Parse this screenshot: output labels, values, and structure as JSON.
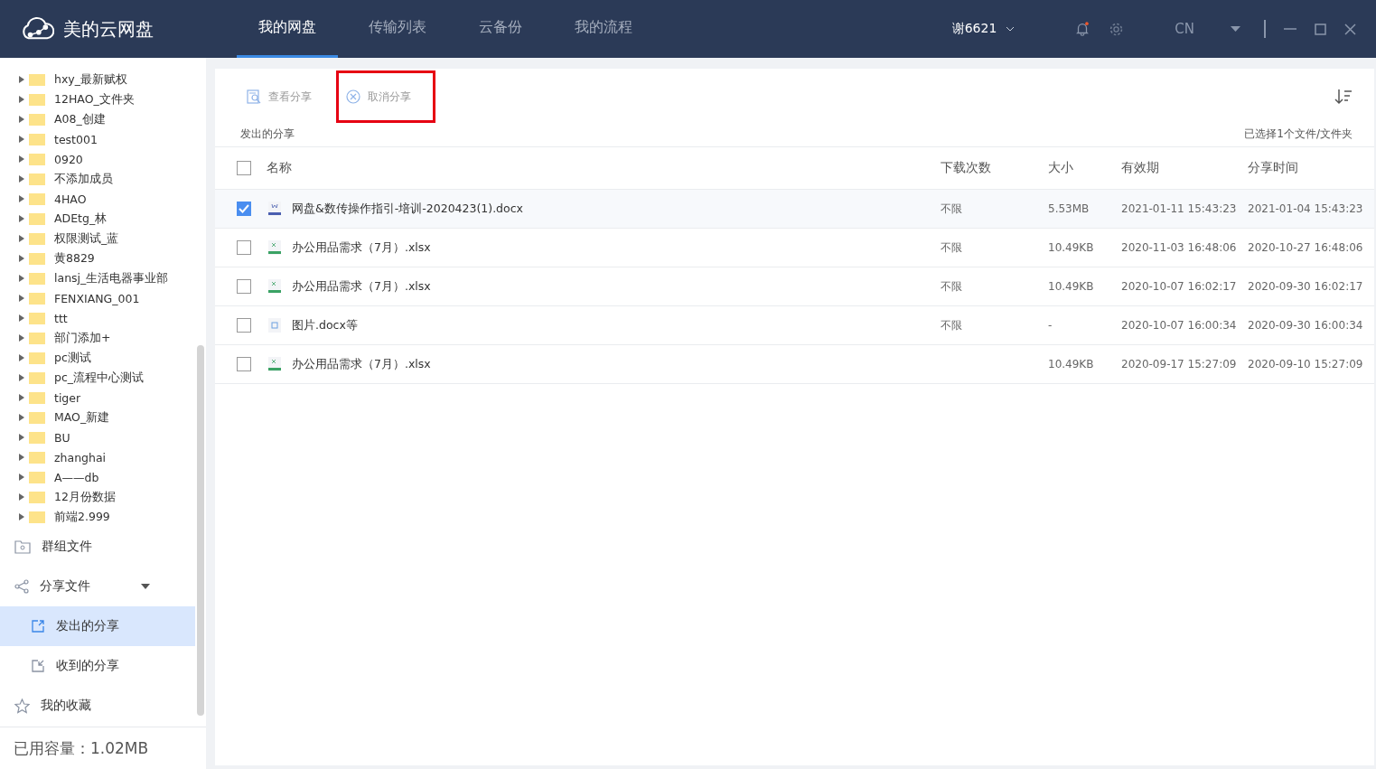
{
  "header": {
    "app_name": "美的云网盘",
    "tabs": [
      {
        "label": "我的网盘",
        "selected": true
      },
      {
        "label": "传输列表",
        "selected": false
      },
      {
        "label": "云备份",
        "selected": false
      },
      {
        "label": "我的流程",
        "selected": false
      }
    ],
    "user": "谢6621",
    "notification_unread": true,
    "language": "CN"
  },
  "sidebar": {
    "folders": [
      {
        "name": "hxy_最新赋权"
      },
      {
        "name": "12HAO_文件夹"
      },
      {
        "name": "A08_创建"
      },
      {
        "name": "test001"
      },
      {
        "name": "0920"
      },
      {
        "name": "不添加成员"
      },
      {
        "name": "4HAO"
      },
      {
        "name": "ADEtg_林"
      },
      {
        "name": "权限测试_蓝"
      },
      {
        "name": "黄8829"
      },
      {
        "name": "lansj_生活电器事业部"
      },
      {
        "name": "FENXIANG_001"
      },
      {
        "name": "ttt"
      },
      {
        "name": "部门添加+"
      },
      {
        "name": "pc测试"
      },
      {
        "name": "pc_流程中心测试"
      },
      {
        "name": "tiger"
      },
      {
        "name": "MAO_新建"
      },
      {
        "name": "BU"
      },
      {
        "name": "zhanghai"
      },
      {
        "name": "A——db"
      },
      {
        "name": "12月份数据"
      },
      {
        "name": "前端2.999"
      }
    ],
    "nav": [
      {
        "kind": "group",
        "label": "群组文件",
        "selected": false
      },
      {
        "kind": "share",
        "label": "分享文件",
        "selected": false,
        "expanded": true,
        "children": [
          {
            "kind": "sent",
            "label": "发出的分享",
            "selected": true
          },
          {
            "kind": "received",
            "label": "收到的分享",
            "selected": false
          }
        ]
      },
      {
        "kind": "star",
        "label": "我的收藏",
        "selected": false
      }
    ],
    "storage": "已用容量：1.02MB"
  },
  "toolbar": {
    "actions": [
      {
        "kind": "view",
        "label": "查看分享",
        "highlighted": false
      },
      {
        "kind": "cancel",
        "label": "取消分享",
        "highlighted": true
      }
    ]
  },
  "section_title": "发出的分享",
  "selection_info": "已选择1个文件/文件夹",
  "table": {
    "columns": [
      "名称",
      "下载次数",
      "大小",
      "有效期",
      "分享时间"
    ],
    "all_checked": false,
    "rows": [
      {
        "kind": "docx",
        "checked": true,
        "cells": [
          "网盘&数传操作指引-培训-2020423(1).docx",
          "不限",
          "5.53MB",
          "2021-01-11 15:43:23",
          "2021-01-04 15:43:23"
        ]
      },
      {
        "kind": "xlsx",
        "checked": false,
        "cells": [
          "办公用品需求（7月）.xlsx",
          "不限",
          "10.49KB",
          "2020-11-03 16:48:06",
          "2020-10-27 16:48:06"
        ]
      },
      {
        "kind": "xlsx",
        "checked": false,
        "cells": [
          "办公用品需求（7月）.xlsx",
          "不限",
          "10.49KB",
          "2020-10-07 16:02:17",
          "2020-09-30 16:02:17"
        ]
      },
      {
        "kind": "image",
        "checked": false,
        "cells": [
          "图片.docx等",
          "不限",
          "-",
          "2020-10-07 16:00:34",
          "2020-09-30 16:00:34"
        ]
      },
      {
        "kind": "xlsx",
        "checked": false,
        "cells": [
          "办公用品需求（7月）.xlsx",
          "",
          "10.49KB",
          "2020-09-17 15:27:09",
          "2020-09-10 15:27:09"
        ]
      }
    ]
  }
}
